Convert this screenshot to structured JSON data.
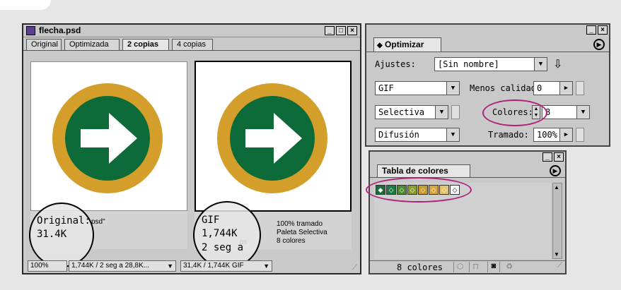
{
  "document_window": {
    "title": "flecha.psd",
    "tabs": [
      "Original",
      "Optimizada",
      "2 copias",
      "4 copias"
    ],
    "active_tab": "2 copias",
    "left_pane": {
      "overlay_label": "Original:",
      "overlay_size": "31.4K",
      "info_fragment": "psd\""
    },
    "right_pane": {
      "overlay_format": "GIF",
      "overlay_size": "1,744K",
      "overlay_time": "2 seg a",
      "info_fragment": "ps",
      "info_lines": [
        "100% tramado",
        "Paleta Selectiva",
        "8 colores"
      ]
    },
    "status": {
      "zoom": "100%",
      "left_info": "1,744K / 2 seg a 28,8K...",
      "right_info": "31,4K / 1,744K GIF"
    }
  },
  "optimize_panel": {
    "title": "Optimizar",
    "settings_label": "Ajustes:",
    "settings_value": "[Sin nombre]",
    "format_value": "GIF",
    "lossy_label": "Menos calidad:",
    "lossy_value": "0",
    "palette_value": "Selectiva",
    "colors_label": "Colores:",
    "colors_value": "8",
    "dither_value": "Difusión",
    "dither_label": "Tramado:",
    "dither_amount": "100%"
  },
  "color_table_panel": {
    "title": "Tabla de colores",
    "count_label": "8 colores",
    "swatches": [
      "#1b6e3a",
      "#1f7a3f",
      "#4d8a2f",
      "#8a9a2c",
      "#c79a2e",
      "#d6a43a",
      "#e6c26a",
      "#ffffff"
    ]
  },
  "colors": {
    "ring": "#d39e2a",
    "green": "#0d6b3a",
    "highlight": "#b0207a"
  }
}
